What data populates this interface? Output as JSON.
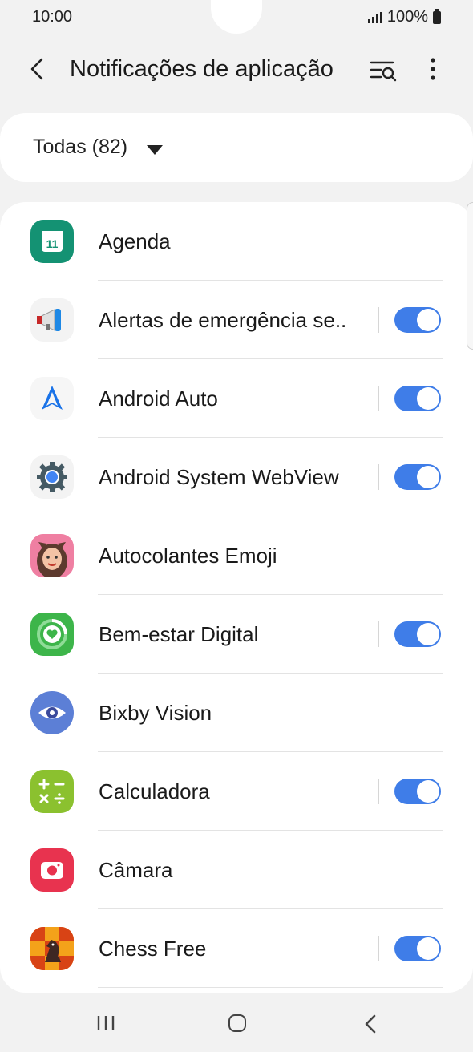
{
  "status_bar": {
    "time": "10:00",
    "battery": "100%"
  },
  "header": {
    "title": "Notificações de aplicação"
  },
  "filter": {
    "label": "Todas (82)"
  },
  "apps": [
    {
      "name": "Agenda",
      "toggle": null,
      "icon": "calendar-icon"
    },
    {
      "name": "Alertas de emergência se..",
      "toggle": true,
      "icon": "megaphone-icon"
    },
    {
      "name": "Android Auto",
      "toggle": true,
      "icon": "android-auto-icon"
    },
    {
      "name": "Android System WebView",
      "toggle": true,
      "icon": "webview-gear-icon"
    },
    {
      "name": "Autocolantes Emoji",
      "toggle": null,
      "icon": "avatar-emoji-icon"
    },
    {
      "name": "Bem-estar Digital",
      "toggle": true,
      "icon": "digital-wellbeing-icon"
    },
    {
      "name": "Bixby Vision",
      "toggle": null,
      "icon": "eye-icon"
    },
    {
      "name": "Calculadora",
      "toggle": true,
      "icon": "calculator-icon"
    },
    {
      "name": "Câmara",
      "toggle": null,
      "icon": "camera-icon"
    },
    {
      "name": "Chess Free",
      "toggle": true,
      "icon": "chess-icon"
    }
  ],
  "colors": {
    "accent": "#3f7de8",
    "background": "#f2f2f2"
  }
}
